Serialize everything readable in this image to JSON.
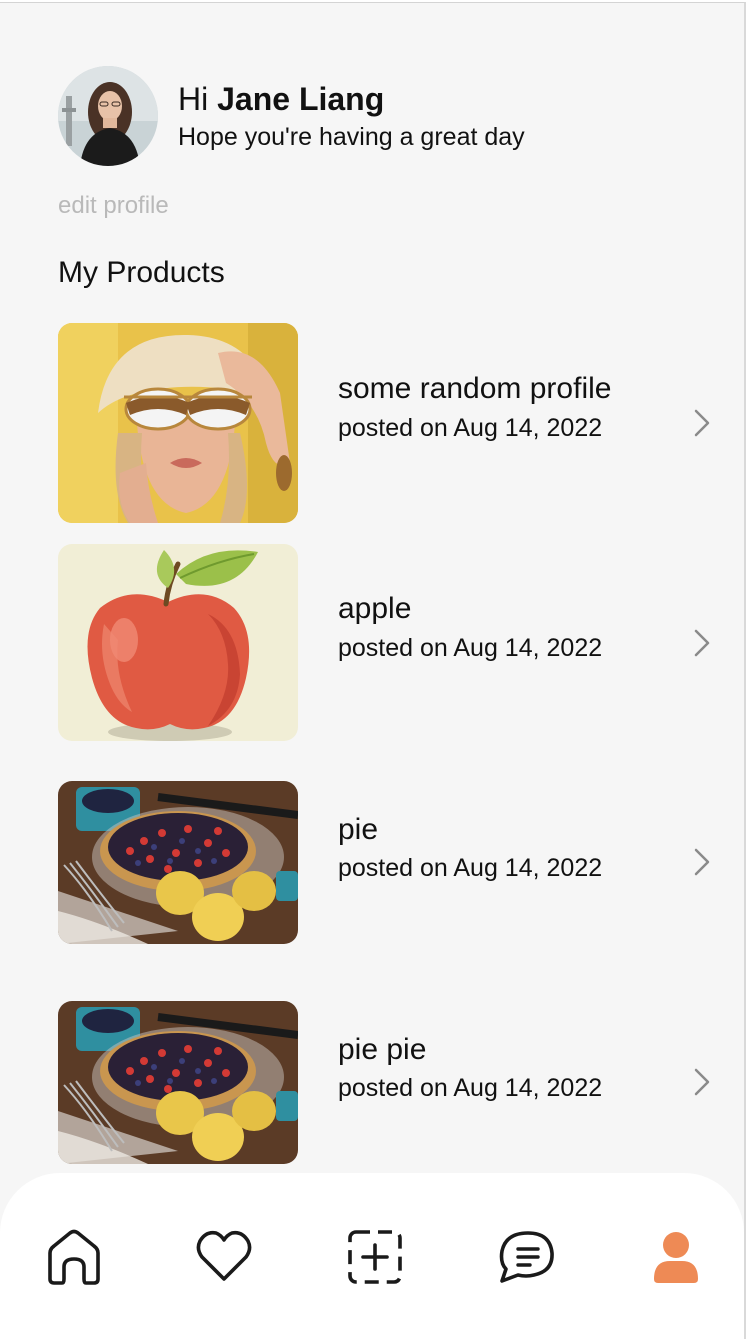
{
  "header": {
    "greeting_prefix": "Hi",
    "user_name": "Jane Liang",
    "subtitle": "Hope you're having a great day",
    "edit_profile": "edit profile"
  },
  "products_section": {
    "title": "My Products",
    "items": [
      {
        "name": "some random profile",
        "posted": "posted on Aug 14, 2022",
        "image": "woman-with-sunglasses"
      },
      {
        "name": "apple",
        "posted": "posted on Aug 14, 2022",
        "image": "red-apple"
      },
      {
        "name": "pie",
        "posted": "posted on Aug 14, 2022",
        "image": "berry-tart"
      },
      {
        "name": "pie pie",
        "posted": "posted on Aug 14, 2022",
        "image": "berry-tart"
      }
    ]
  },
  "bottom_nav": {
    "items": [
      {
        "icon": "home-icon",
        "active": false
      },
      {
        "icon": "heart-icon",
        "active": false
      },
      {
        "icon": "add-square-icon",
        "active": false
      },
      {
        "icon": "chat-icon",
        "active": false
      },
      {
        "icon": "profile-icon",
        "active": true
      }
    ],
    "active_color": "#ee8a55",
    "inactive_color": "#1a1a1a"
  }
}
